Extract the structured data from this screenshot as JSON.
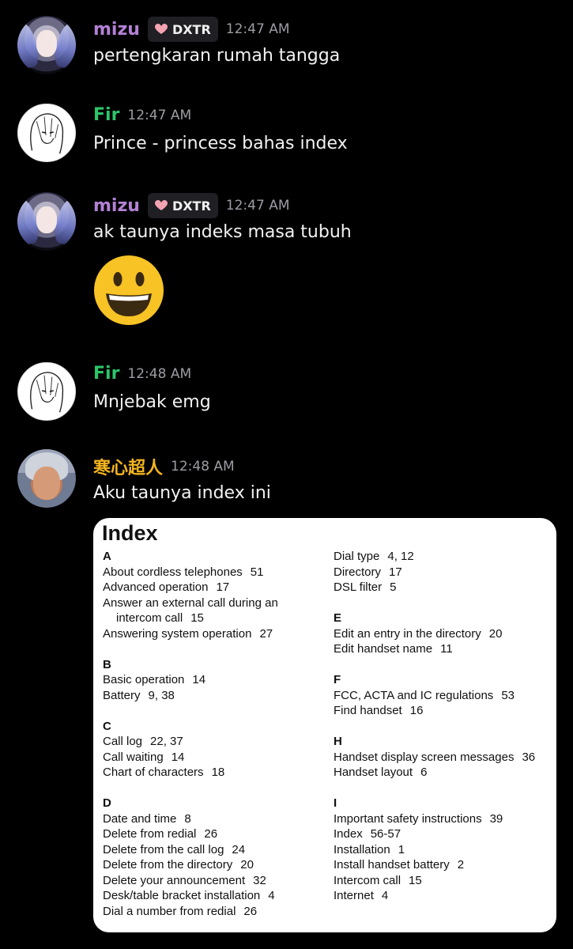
{
  "messages": [
    {
      "user": "mizu",
      "tag": "DXTR",
      "time": "12:47 AM",
      "text": "pertengkaran rumah tangga"
    },
    {
      "user": "Fir",
      "time": "12:47 AM",
      "text": "Prince - princess bahas index"
    },
    {
      "user": "mizu",
      "tag": "DXTR",
      "time": "12:47 AM",
      "text": "ak taunya indeks masa tubuh"
    },
    {
      "user": "Fir",
      "time": "12:48 AM",
      "text": "Mnjebak emg"
    },
    {
      "user": "寒心超人",
      "time": "12:48 AM",
      "text": "Aku taunya index ini"
    }
  ],
  "index_image": {
    "title": "Index",
    "left": [
      {
        "letter": "A"
      },
      {
        "t": "About cordless telephones",
        "p": "51"
      },
      {
        "t": "Advanced operation",
        "p": "17"
      },
      {
        "t": "Answer an external call during an",
        "p": ""
      },
      {
        "t": "intercom call",
        "p": "15",
        "indent": true
      },
      {
        "t": "Answering system operation",
        "p": "27"
      },
      {
        "gap": true
      },
      {
        "letter": "B"
      },
      {
        "t": "Basic operation",
        "p": "14"
      },
      {
        "t": "Battery",
        "p": "9, 38"
      },
      {
        "gap": true
      },
      {
        "letter": "C"
      },
      {
        "t": "Call log",
        "p": "22, 37"
      },
      {
        "t": "Call waiting",
        "p": "14"
      },
      {
        "t": "Chart of characters",
        "p": "18"
      },
      {
        "gap": true
      },
      {
        "letter": "D"
      },
      {
        "t": "Date and time",
        "p": "8"
      },
      {
        "t": "Delete from redial",
        "p": "26"
      },
      {
        "t": "Delete from the call log",
        "p": "24"
      },
      {
        "t": "Delete from the directory",
        "p": "20"
      },
      {
        "t": "Delete your announcement",
        "p": "32"
      },
      {
        "t": "Desk/table bracket installation",
        "p": "4"
      },
      {
        "t": "Dial a number from redial",
        "p": "26"
      }
    ],
    "right": [
      {
        "t": "Dial type",
        "p": "4, 12"
      },
      {
        "t": "Directory",
        "p": "17"
      },
      {
        "t": "DSL filter",
        "p": "5"
      },
      {
        "gap": true
      },
      {
        "letter": "E"
      },
      {
        "t": "Edit an entry in the directory",
        "p": "20"
      },
      {
        "t": "Edit handset name",
        "p": "11"
      },
      {
        "gap": true
      },
      {
        "letter": "F"
      },
      {
        "t": "FCC, ACTA and IC regulations",
        "p": "53"
      },
      {
        "t": "Find handset",
        "p": "16"
      },
      {
        "gap": true
      },
      {
        "letter": "H"
      },
      {
        "t": "Handset display screen messages",
        "p": "36"
      },
      {
        "t": "Handset layout",
        "p": "6"
      },
      {
        "gap": true
      },
      {
        "letter": "I"
      },
      {
        "t": "Important safety instructions",
        "p": "39"
      },
      {
        "t": "Index",
        "p": "56-57"
      },
      {
        "t": "Installation",
        "p": "1"
      },
      {
        "t": "Install handset battery",
        "p": "2"
      },
      {
        "t": "Intercom call",
        "p": "15"
      },
      {
        "t": "Internet",
        "p": "4"
      }
    ]
  },
  "colors": {
    "mizu": "#b481d6",
    "fir": "#2dc56b",
    "han": "#f2b41f",
    "timestamp": "#9c9ca4"
  },
  "icons": {
    "tag_icon": "pink-heart-icon",
    "emoji": "grinning-face-emoji"
  }
}
